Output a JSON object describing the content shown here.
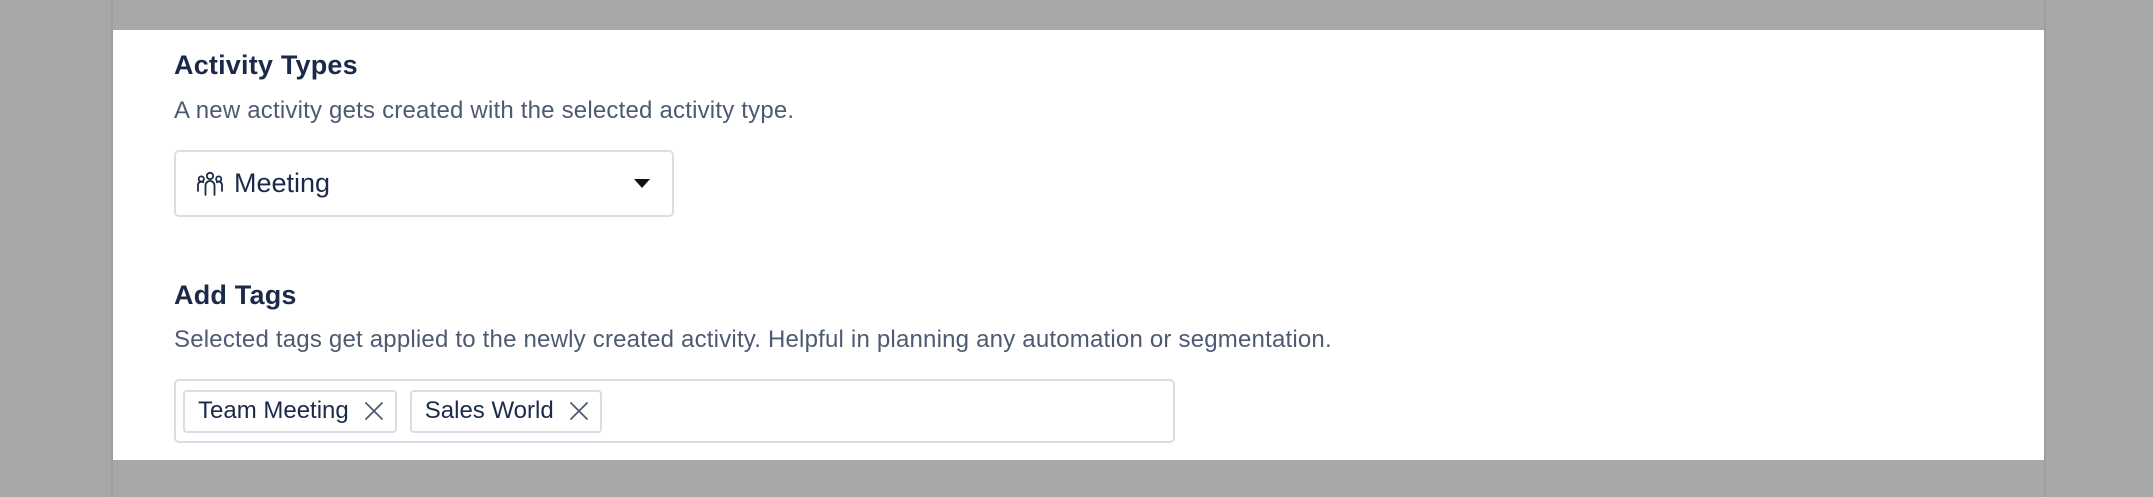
{
  "activity_types": {
    "title": "Activity Types",
    "description": "A new activity gets created with the selected activity type.",
    "selected_value": "Meeting",
    "selected_icon": "people-group-icon"
  },
  "add_tags": {
    "title": "Add Tags",
    "description": "Selected tags get applied to the newly created activity. Helpful in planning any automation or segmentation.",
    "tags": [
      {
        "label": "Team Meeting"
      },
      {
        "label": "Sales World"
      }
    ],
    "input_value": ""
  },
  "colors": {
    "backdrop": "#a8a8a9",
    "heading": "#1c2a4a",
    "muted_text": "#4d5b72",
    "border": "#d9dde6"
  }
}
